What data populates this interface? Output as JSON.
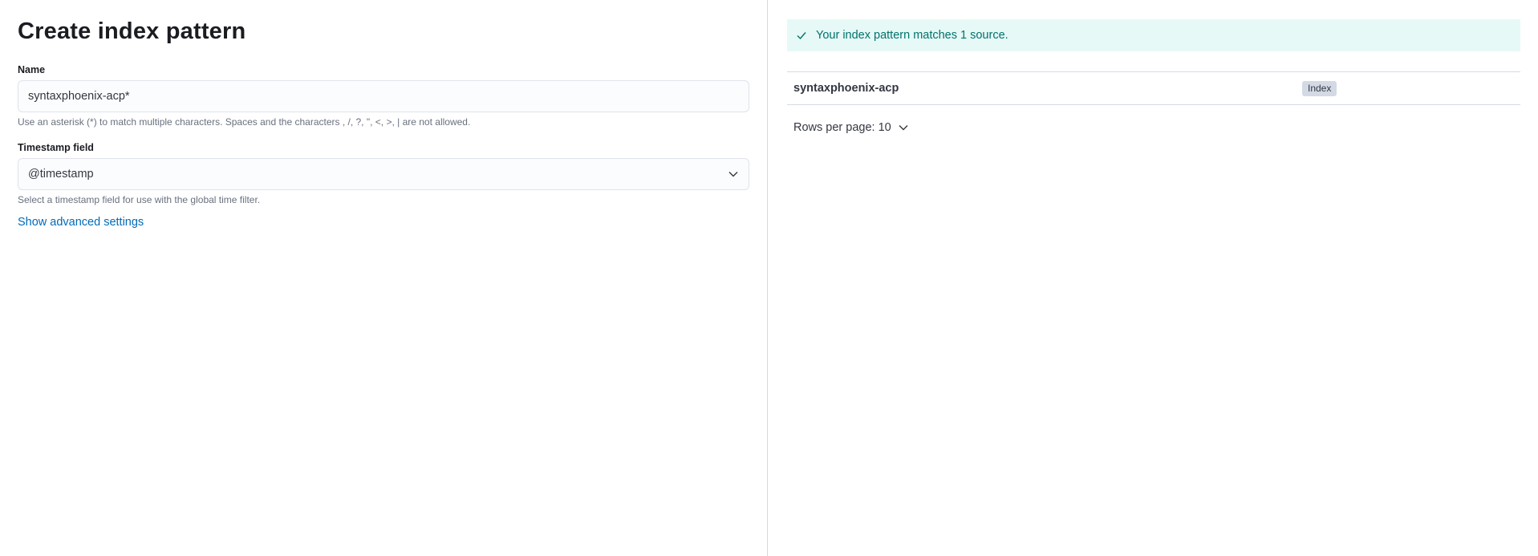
{
  "form": {
    "title": "Create index pattern",
    "name_label": "Name",
    "name_value": "syntaxphoenix-acp*",
    "name_help": "Use an asterisk (*) to match multiple characters. Spaces and the characters , /, ?, \", <, >, | are not allowed.",
    "timestamp_label": "Timestamp field",
    "timestamp_value": "@timestamp",
    "timestamp_help": "Select a timestamp field for use with the global time filter.",
    "advanced_link": "Show advanced settings"
  },
  "results": {
    "callout": "Your index pattern matches 1 source.",
    "rows": [
      {
        "name": "syntaxphoenix-acp",
        "type": "Index"
      }
    ],
    "rows_per_page": "Rows per page: 10"
  },
  "icons": {
    "callout_icon": "check-icon",
    "select_icon": "chevron-down-icon",
    "pager_icon": "chevron-down-icon"
  },
  "colors": {
    "link": "#006bb8",
    "success_text": "#00726b",
    "success_bg": "#e6f9f7",
    "badge_bg": "#d3dae6"
  }
}
